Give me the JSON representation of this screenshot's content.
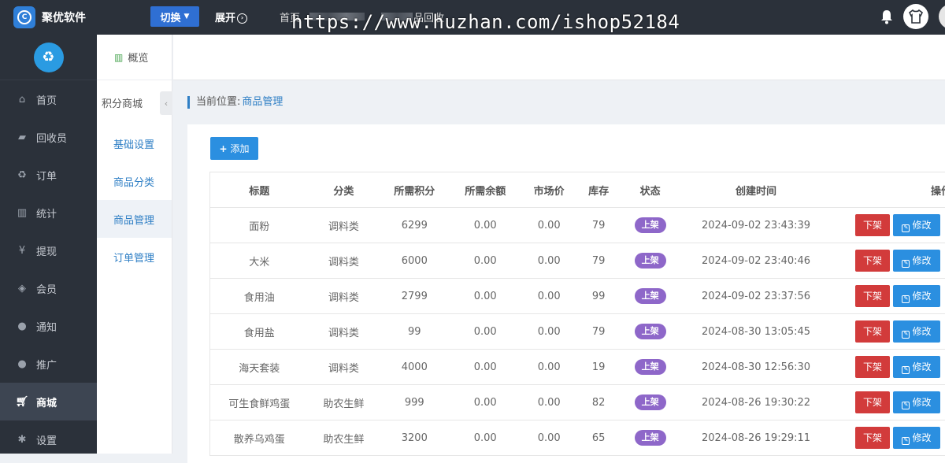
{
  "topbar": {
    "brand": "聚优软件",
    "switch_label": "切换",
    "expand_label": "展开",
    "nav_home": "首页",
    "nav_partial": "品回收",
    "watermark": "https://www.huzhan.com/ishop52184"
  },
  "sidebar": {
    "items": [
      {
        "label": "首页",
        "icon": "home-icon"
      },
      {
        "label": "回收员",
        "icon": "truck-icon"
      },
      {
        "label": "订单",
        "icon": "recycle-icon"
      },
      {
        "label": "统计",
        "icon": "bar-chart-icon"
      },
      {
        "label": "提现",
        "icon": "yen-icon"
      },
      {
        "label": "会员",
        "icon": "tag-icon"
      },
      {
        "label": "通知",
        "icon": "chat-icon"
      },
      {
        "label": "推广",
        "icon": "chat-icon"
      },
      {
        "label": "商城",
        "icon": "cart-icon"
      },
      {
        "label": "设置",
        "icon": "gear-icon"
      }
    ]
  },
  "subbar": {
    "overview": "概览",
    "group": "积分商城",
    "items": [
      "基础设置",
      "商品分类",
      "商品管理",
      "订单管理"
    ]
  },
  "breadcrumb": {
    "label": "当前位置:",
    "current": "商品管理"
  },
  "toolbar": {
    "add_label": "添加"
  },
  "table": {
    "headers": [
      "标题",
      "分类",
      "所需积分",
      "所需余额",
      "市场价",
      "库存",
      "状态",
      "创建时间",
      "操作"
    ],
    "rows": [
      {
        "title": "面粉",
        "category": "调料类",
        "points": "6299",
        "balance": "0.00",
        "market_price": "0.00",
        "stock": "79",
        "status": "上架",
        "created": "2024-09-02 23:43:39"
      },
      {
        "title": "大米",
        "category": "调料类",
        "points": "6000",
        "balance": "0.00",
        "market_price": "0.00",
        "stock": "79",
        "status": "上架",
        "created": "2024-09-02 23:40:46"
      },
      {
        "title": "食用油",
        "category": "调料类",
        "points": "2799",
        "balance": "0.00",
        "market_price": "0.00",
        "stock": "99",
        "status": "上架",
        "created": "2024-09-02 23:37:56"
      },
      {
        "title": "食用盐",
        "category": "调料类",
        "points": "99",
        "balance": "0.00",
        "market_price": "0.00",
        "stock": "79",
        "status": "上架",
        "created": "2024-08-30 13:05:45"
      },
      {
        "title": "海天套装",
        "category": "调料类",
        "points": "4000",
        "balance": "0.00",
        "market_price": "0.00",
        "stock": "19",
        "status": "上架",
        "created": "2024-08-30 12:56:30"
      },
      {
        "title": "可生食鲜鸡蛋",
        "category": "助农生鲜",
        "points": "999",
        "balance": "0.00",
        "market_price": "0.00",
        "stock": "82",
        "status": "上架",
        "created": "2024-08-26 19:30:22"
      },
      {
        "title": "散养乌鸡蛋",
        "category": "助农生鲜",
        "points": "3200",
        "balance": "0.00",
        "market_price": "0.00",
        "stock": "65",
        "status": "上架",
        "created": "2024-08-26 19:29:11"
      }
    ],
    "action_down": "下架",
    "action_edit": "修改"
  },
  "colors": {
    "topbar_bg": "#2b313a",
    "accent_blue": "#2b8fe0",
    "status_purple": "#8e67c9",
    "danger_red": "#d23b3b"
  }
}
